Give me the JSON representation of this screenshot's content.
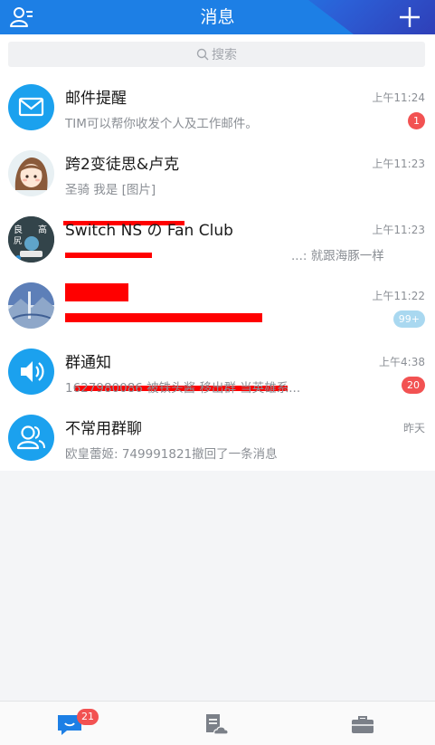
{
  "header": {
    "title": "消息",
    "left_icon": "contacts-icon",
    "right_icon": "plus-icon"
  },
  "search": {
    "placeholder": "搜索",
    "icon": "search-icon"
  },
  "conversations": [
    {
      "name": "邮件提醒",
      "preview": "TIM可以帮你收发个人及工作邮件。",
      "time": "上午11:24",
      "badge": "1",
      "avatar": "mail-icon"
    },
    {
      "name": "跨2变徒思&卢克",
      "preview": "圣骑 我是 [图片]",
      "time": "上午11:23",
      "badge": "",
      "avatar": "cartoon-girl-avatar"
    },
    {
      "name": "Switch NS の Fan Club",
      "preview": "...: 就跟海豚一样",
      "time": "上午11:23",
      "badge": "",
      "avatar": "group-avatar"
    },
    {
      "name": "",
      "preview": "",
      "time": "上午11:22",
      "badge": "99+",
      "avatar": "landscape-avatar"
    },
    {
      "name": "群通知",
      "preview": "1627980086 被铁头酱 移出群 当英雄系...",
      "time": "上午4:38",
      "badge": "20",
      "avatar": "speaker-icon"
    },
    {
      "name": "不常用群聊",
      "preview": "欧皇蕾姬: 749991821撤回了一条消息",
      "time": "昨天",
      "badge": "",
      "avatar": "people-icon"
    }
  ],
  "tabbar": {
    "tabs": [
      {
        "name": "messages",
        "icon": "chat-icon"
      },
      {
        "name": "docs",
        "icon": "document-cloud-icon"
      },
      {
        "name": "work",
        "icon": "briefcase-icon"
      }
    ],
    "messages_badge": "21"
  },
  "colors": {
    "accent": "#1d7fe5",
    "badge": "#f25252",
    "muted_badge": "#a9d8f0"
  }
}
